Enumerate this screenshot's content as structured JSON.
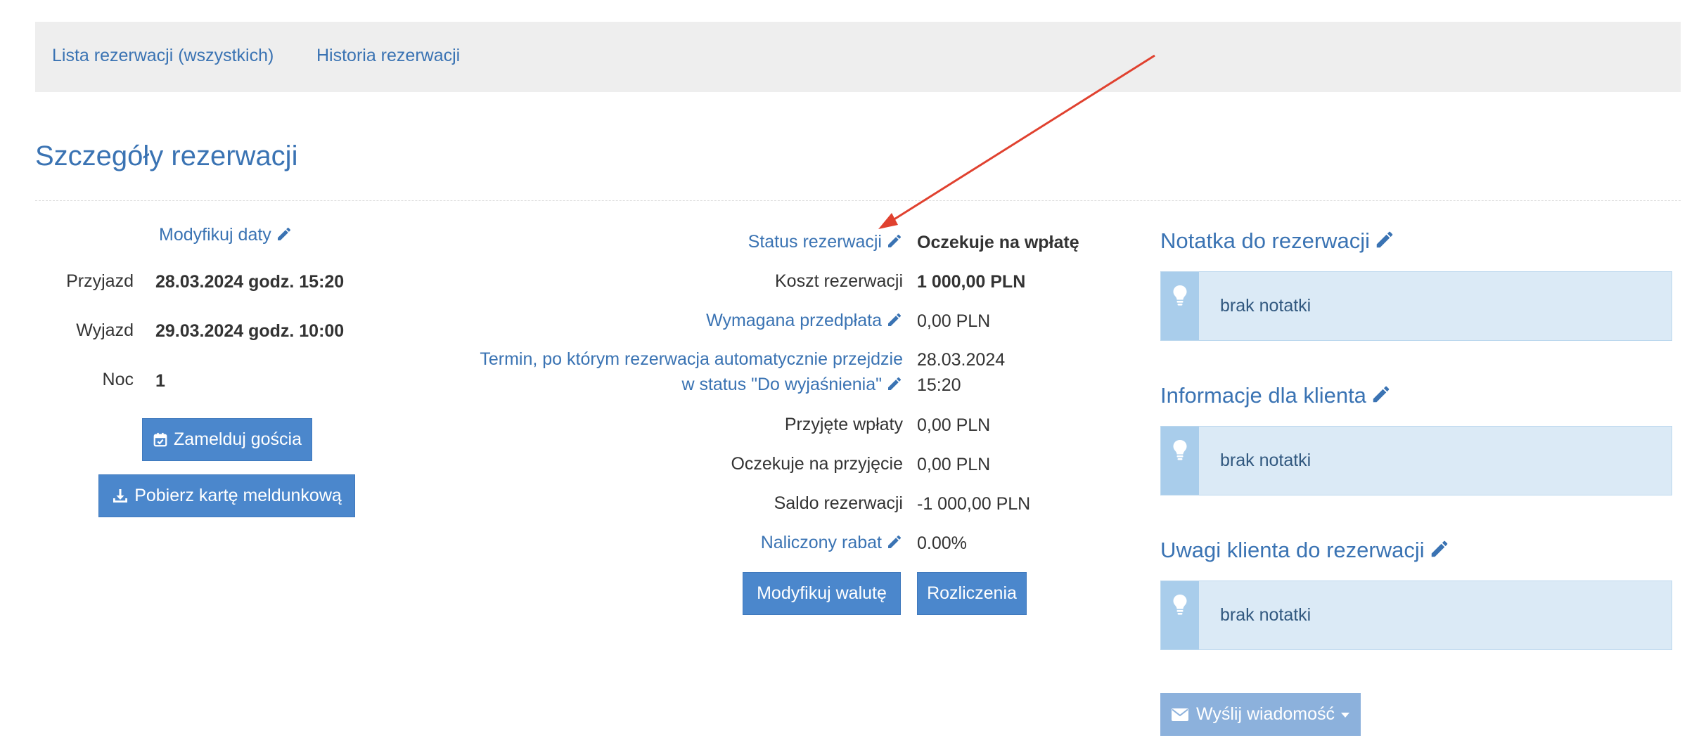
{
  "nav": {
    "items": [
      "Lista rezerwacji (wszystkich)",
      "Historia rezerwacji"
    ]
  },
  "page_title": "Szczegóły rezerwacji",
  "left": {
    "modify_dates": "Modyfikuj daty",
    "arrival_label": "Przyjazd",
    "arrival_value": "28.03.2024 godz. 15:20",
    "departure_label": "Wyjazd",
    "departure_value": "29.03.2024 godz. 10:00",
    "nights_label": "Noc",
    "nights_value": "1",
    "checkin_button": "Zamelduj gościa",
    "download_button": "Pobierz kartę meldunkową"
  },
  "details": {
    "status_label": "Status rezerwacji",
    "status_value": "Oczekuje na wpłatę",
    "cost_label": "Koszt rezerwacji",
    "cost_value": "1 000,00 PLN",
    "prepayment_label": "Wymagana przedpłata",
    "prepayment_value": "0,00 PLN",
    "deadline_label_line1": "Termin, po którym rezerwacja automatycznie przejdzie",
    "deadline_label_line2": "w status \"Do wyjaśnienia\"",
    "deadline_date": "28.03.2024",
    "deadline_time": "15:20",
    "received_label": "Przyjęte wpłaty",
    "received_value": "0,00 PLN",
    "pending_label": "Oczekuje na przyjęcie",
    "pending_value": "0,00 PLN",
    "balance_label": "Saldo rezerwacji",
    "balance_value": "-1 000,00 PLN",
    "discount_label": "Naliczony rabat",
    "discount_value": "0.00%",
    "modify_currency_button": "Modyfikuj walutę",
    "settlements_button": "Rozliczenia"
  },
  "notes": {
    "reservation_note_title": "Notatka do rezerwacji",
    "reservation_note_text": "brak notatki",
    "client_info_title": "Informacje dla klienta",
    "client_info_text": "brak notatki",
    "client_remarks_title": "Uwagi klienta do rezerwacji",
    "client_remarks_text": "brak notatki",
    "send_message_button": "Wyślij wiadomość"
  },
  "colors": {
    "link": "#3a73b3",
    "button": "#4b87cc",
    "note_bg": "#dbeaf6",
    "annotation_arrow": "#e0412f"
  }
}
